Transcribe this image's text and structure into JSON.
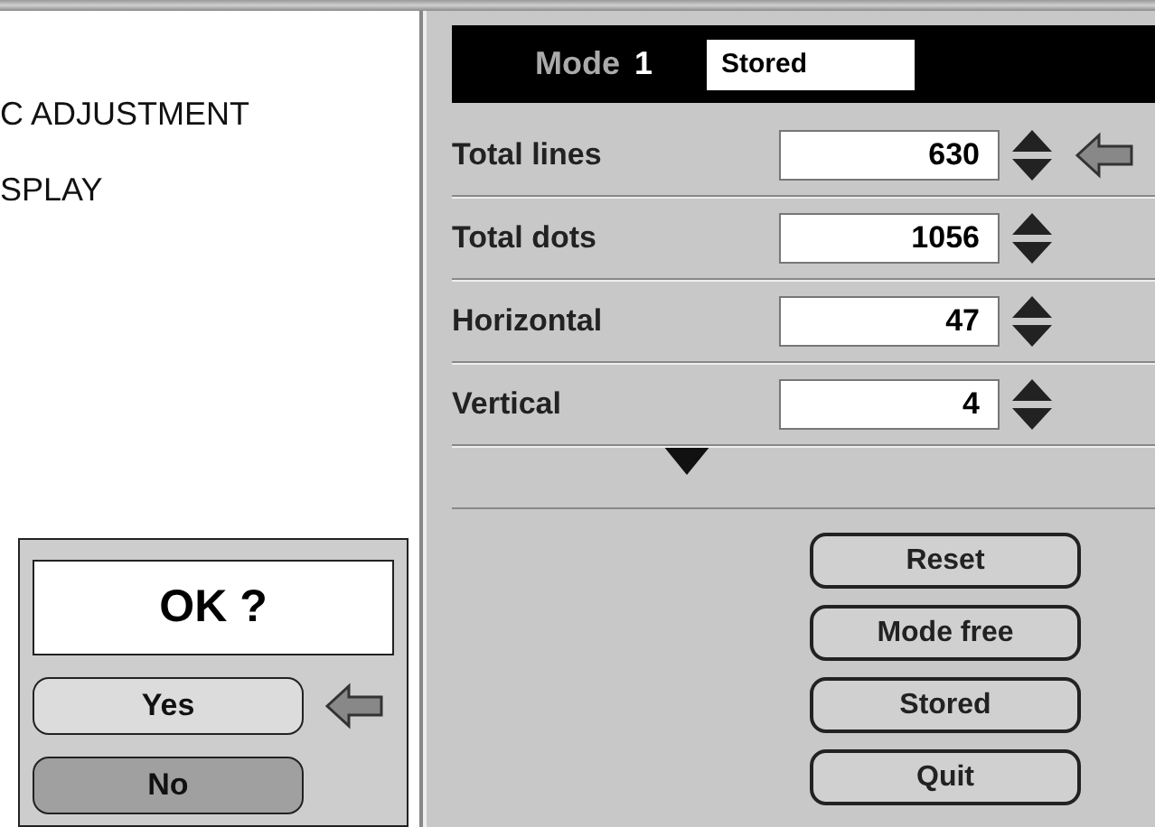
{
  "menu_items": [
    "C ADJUSTMENT",
    "SPLAY"
  ],
  "confirm_dialog": {
    "title": "OK ?",
    "options": [
      {
        "label": "Yes",
        "selected": true,
        "shaded": false
      },
      {
        "label": "No",
        "selected": false,
        "shaded": true
      }
    ]
  },
  "adjust_panel": {
    "mode_label": "Mode",
    "mode_number": "1",
    "mode_status": "Stored",
    "rows": [
      {
        "label": "Total lines",
        "value": "630",
        "selected": true
      },
      {
        "label": "Total dots",
        "value": "1056",
        "selected": false
      },
      {
        "label": "Horizontal",
        "value": "47",
        "selected": false
      },
      {
        "label": "Vertical",
        "value": "4",
        "selected": false
      }
    ],
    "buttons": [
      "Reset",
      "Mode free",
      "Stored",
      "Quit"
    ]
  }
}
